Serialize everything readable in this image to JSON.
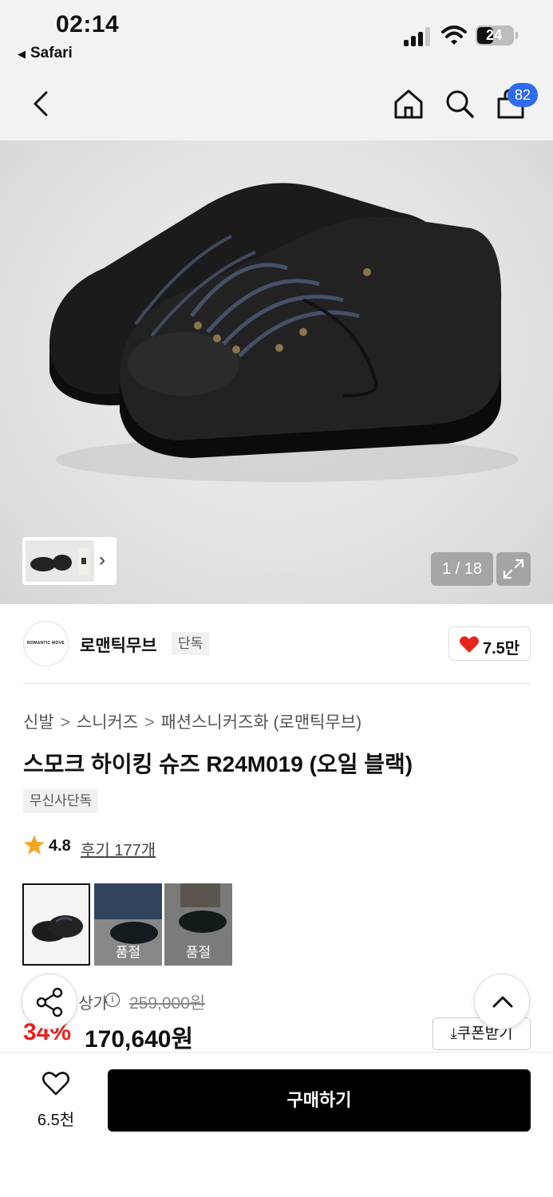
{
  "status": {
    "time": "02:14",
    "back_app": "Safari",
    "battery": "24"
  },
  "nav": {
    "cart_count": "82"
  },
  "gallery": {
    "counter": "1 / 18"
  },
  "brand": {
    "name": "로맨틱무브",
    "tag": "단독",
    "logo_text": "ROMANTIC MOVE",
    "likes": "7.5만"
  },
  "breadcrumb": [
    "신발",
    "스니커즈",
    "패션스니커즈화 (로맨틱무브)"
  ],
  "product": {
    "title": "스모크 하이킹 슈즈 R24M019 (오일 블랙)",
    "tag": "무신사단독",
    "rating": "4.8",
    "reviews": "후기 177개"
  },
  "options": [
    {
      "sold_out": ""
    },
    {
      "sold_out": "품절"
    },
    {
      "sold_out": "품절"
    }
  ],
  "price": {
    "original_label": "정상가",
    "original": "259,000원",
    "discount": "34%",
    "sale": "170,640원",
    "coupon": "쿠폰받기"
  },
  "bottom": {
    "wish_count": "6.5천",
    "buy_label": "구매하기"
  },
  "colors": {
    "accent_blue": "#2f6bf0",
    "discount_red": "#e8231e",
    "heart_red": "#e8231e"
  }
}
